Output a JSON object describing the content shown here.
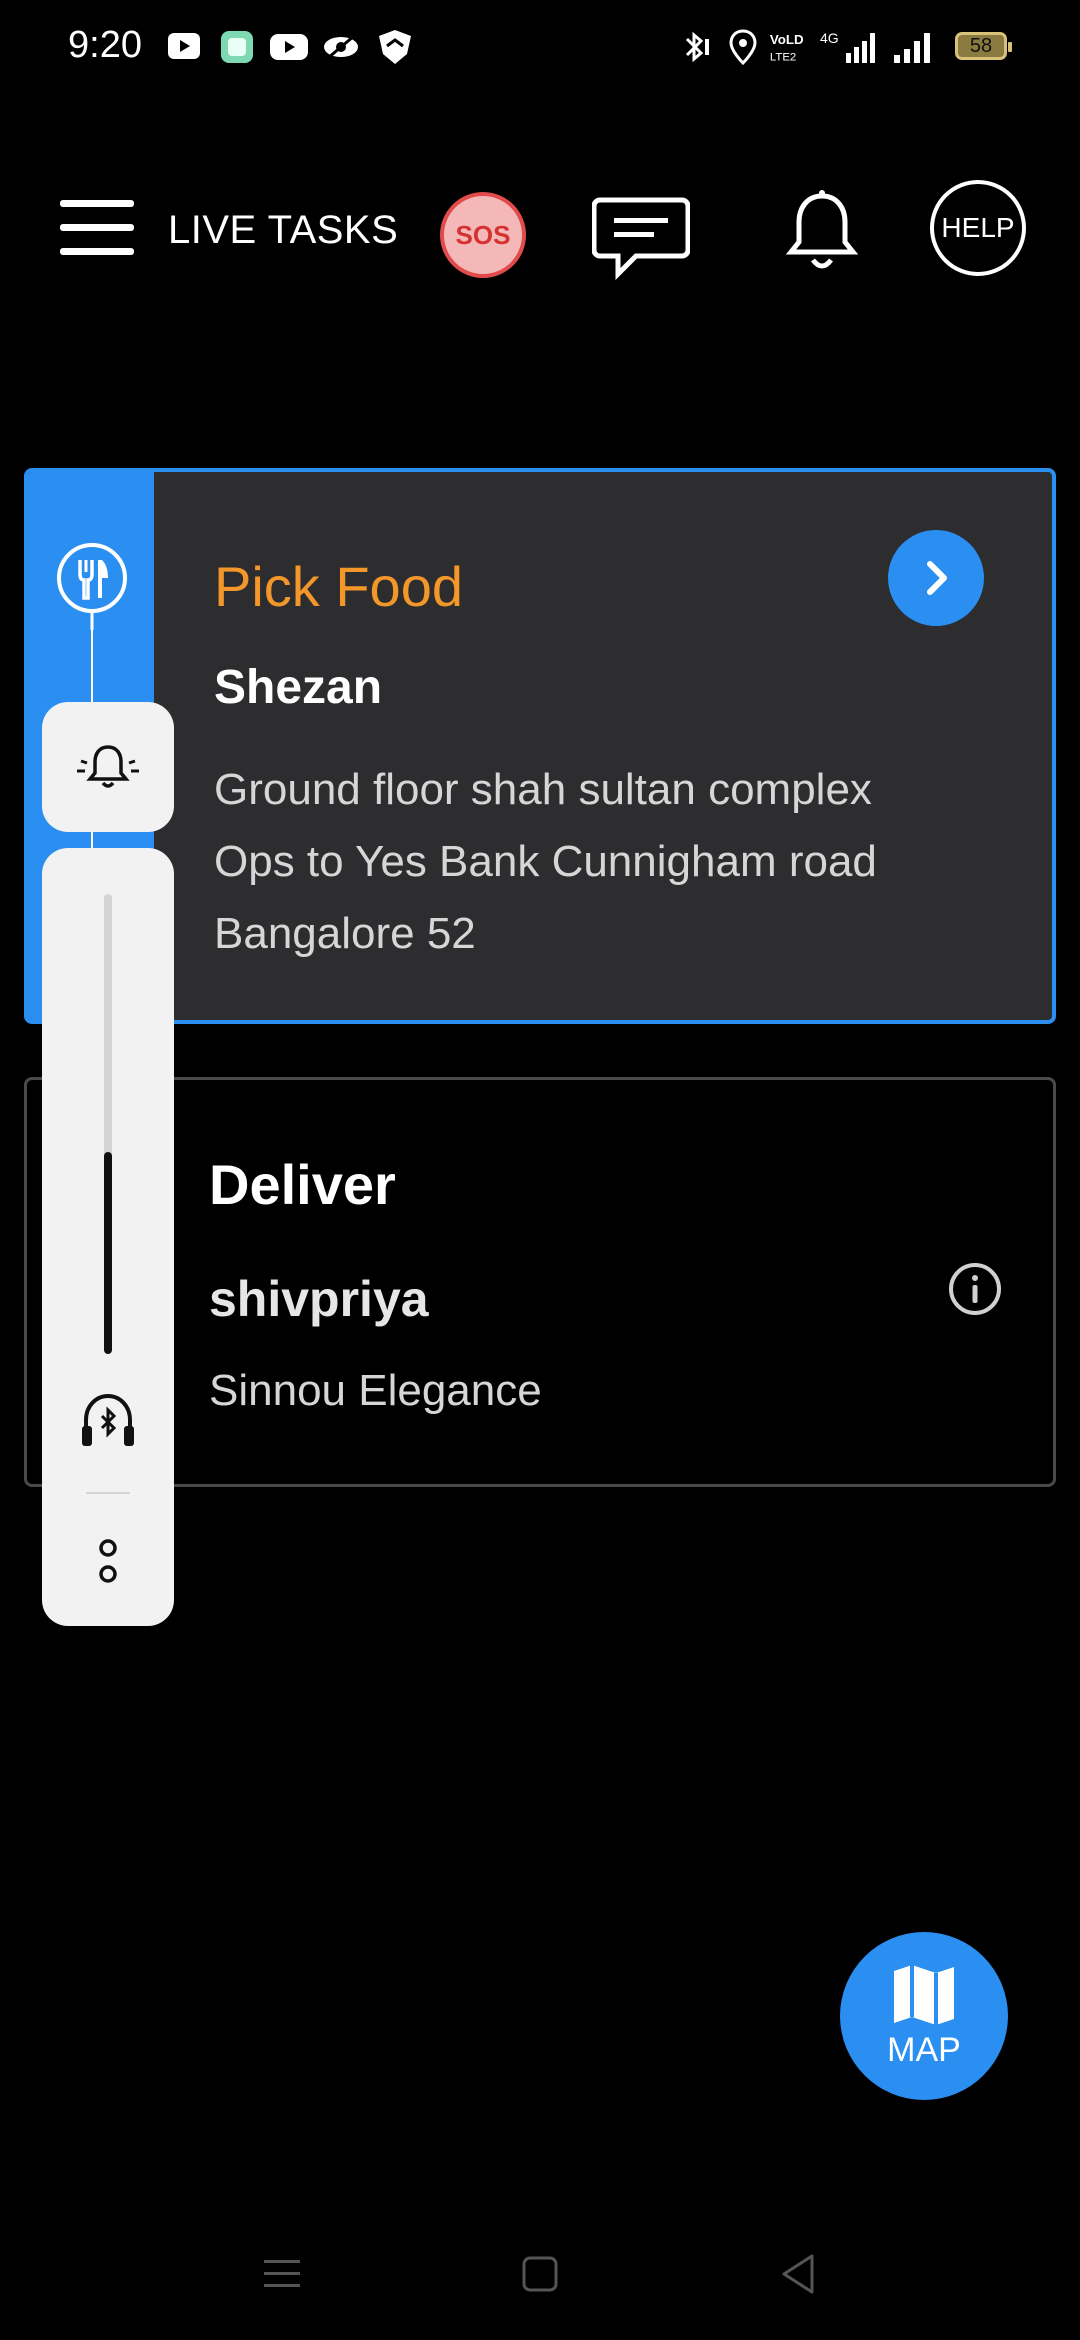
{
  "status_bar": {
    "time": "9:20",
    "battery": "58",
    "network": "4G",
    "volte": "VoLTE"
  },
  "header": {
    "title": "LIVE TASKS",
    "sos_label": "SOS",
    "help_label": "HELP"
  },
  "pick_task": {
    "heading": "Pick Food",
    "restaurant": "Shezan",
    "address_lines": [
      "Ground floor  shah sultan complex",
      "Ops to Yes Bank  Cunnigham road",
      "Bangalore 52"
    ],
    "accent_color": "#2a8ff0",
    "heading_color": "#f3972b"
  },
  "deliver_task": {
    "heading": "Deliver",
    "customer": "shivpriya",
    "address": "Sinnou Elegance"
  },
  "volume_panel": {
    "level": 0.44
  },
  "map_button": {
    "label": "MAP"
  },
  "icons": [
    "menu-icon",
    "sos",
    "chat-icon",
    "bell-icon",
    "help",
    "fork-knife-icon",
    "chevron-right-icon",
    "info-icon",
    "bell-ring-icon",
    "bluetooth-headset-icon",
    "more-icon",
    "map-icon"
  ]
}
